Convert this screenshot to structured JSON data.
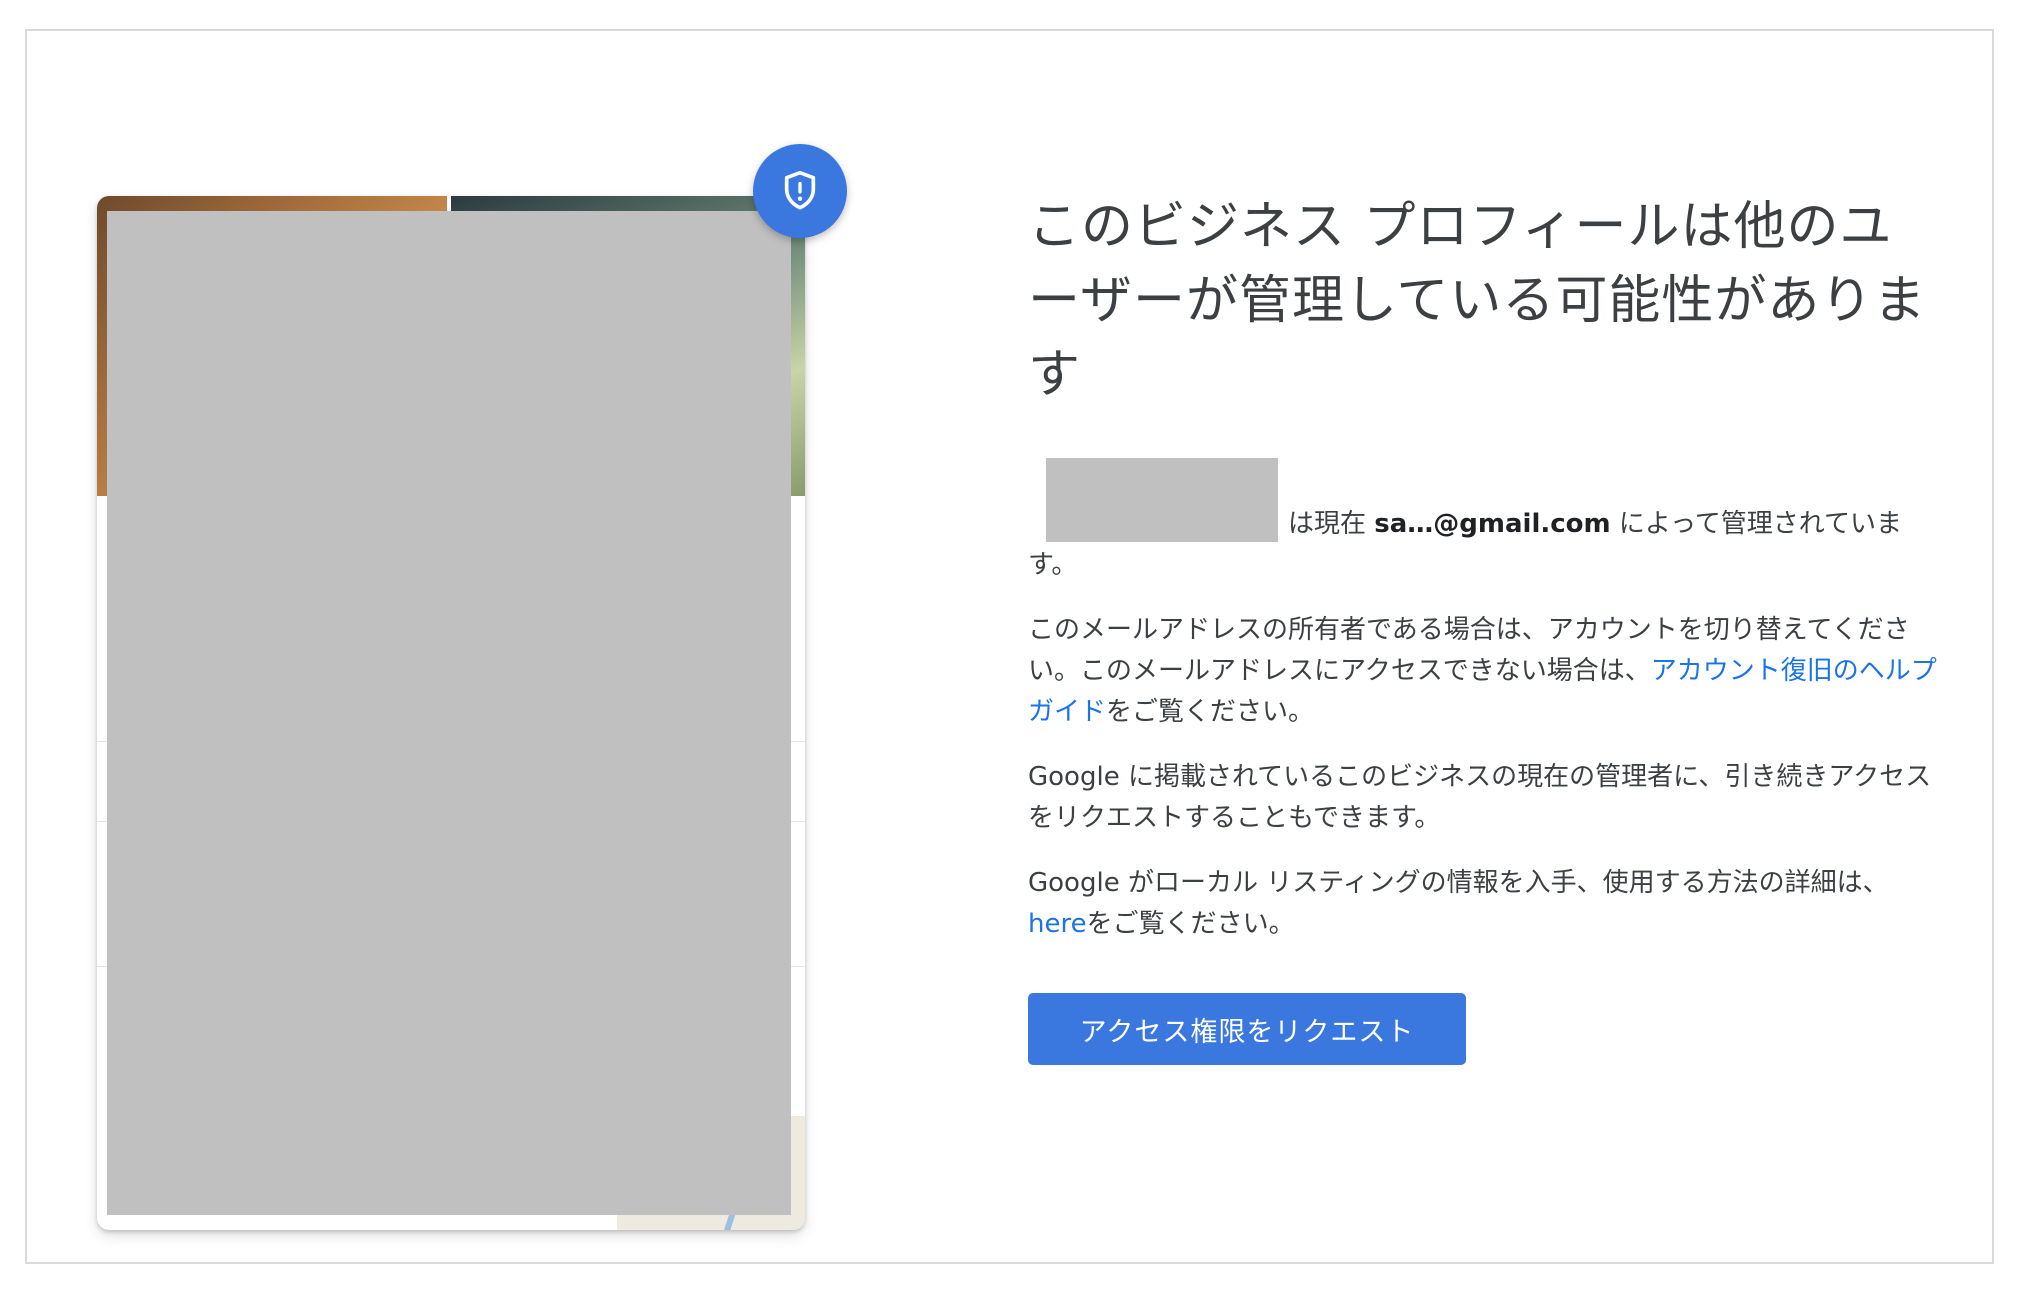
{
  "page": {
    "title": "このビジネス プロフィールは他のユーザーが管理している可能性があります",
    "owner": {
      "prefix": "は現在",
      "email": "sa…@gmail.com",
      "suffix": "によって管理されています。"
    },
    "paragraph_switch": {
      "text_before": "このメールアドレスの所有者である場合は、アカウントを切り替えてください。このメールアドレスにアクセスできない場合は、",
      "link_text": "アカウント復旧のヘルプガイド",
      "text_after": "をご覧ください。"
    },
    "paragraph_request": "Google に掲載されているこのビジネスの現在の管理者に、引き続きアクセスをリクエストすることもできます。",
    "paragraph_info": {
      "text_before": "Google がローカル リスティングの情報を入手、使用する方法の詳細は、",
      "link_text": "here",
      "text_after": "をご覧ください。"
    },
    "request_button_label": "アクセス権限をリクエスト"
  },
  "preview_card": {
    "badge_icon": "shield-exclamation-icon",
    "badge_color": "#3a78e0"
  },
  "colors": {
    "accent": "#3a78e0",
    "link": "#1a73e8",
    "text": "#3c4043",
    "redaction": "#c0c0c0"
  }
}
